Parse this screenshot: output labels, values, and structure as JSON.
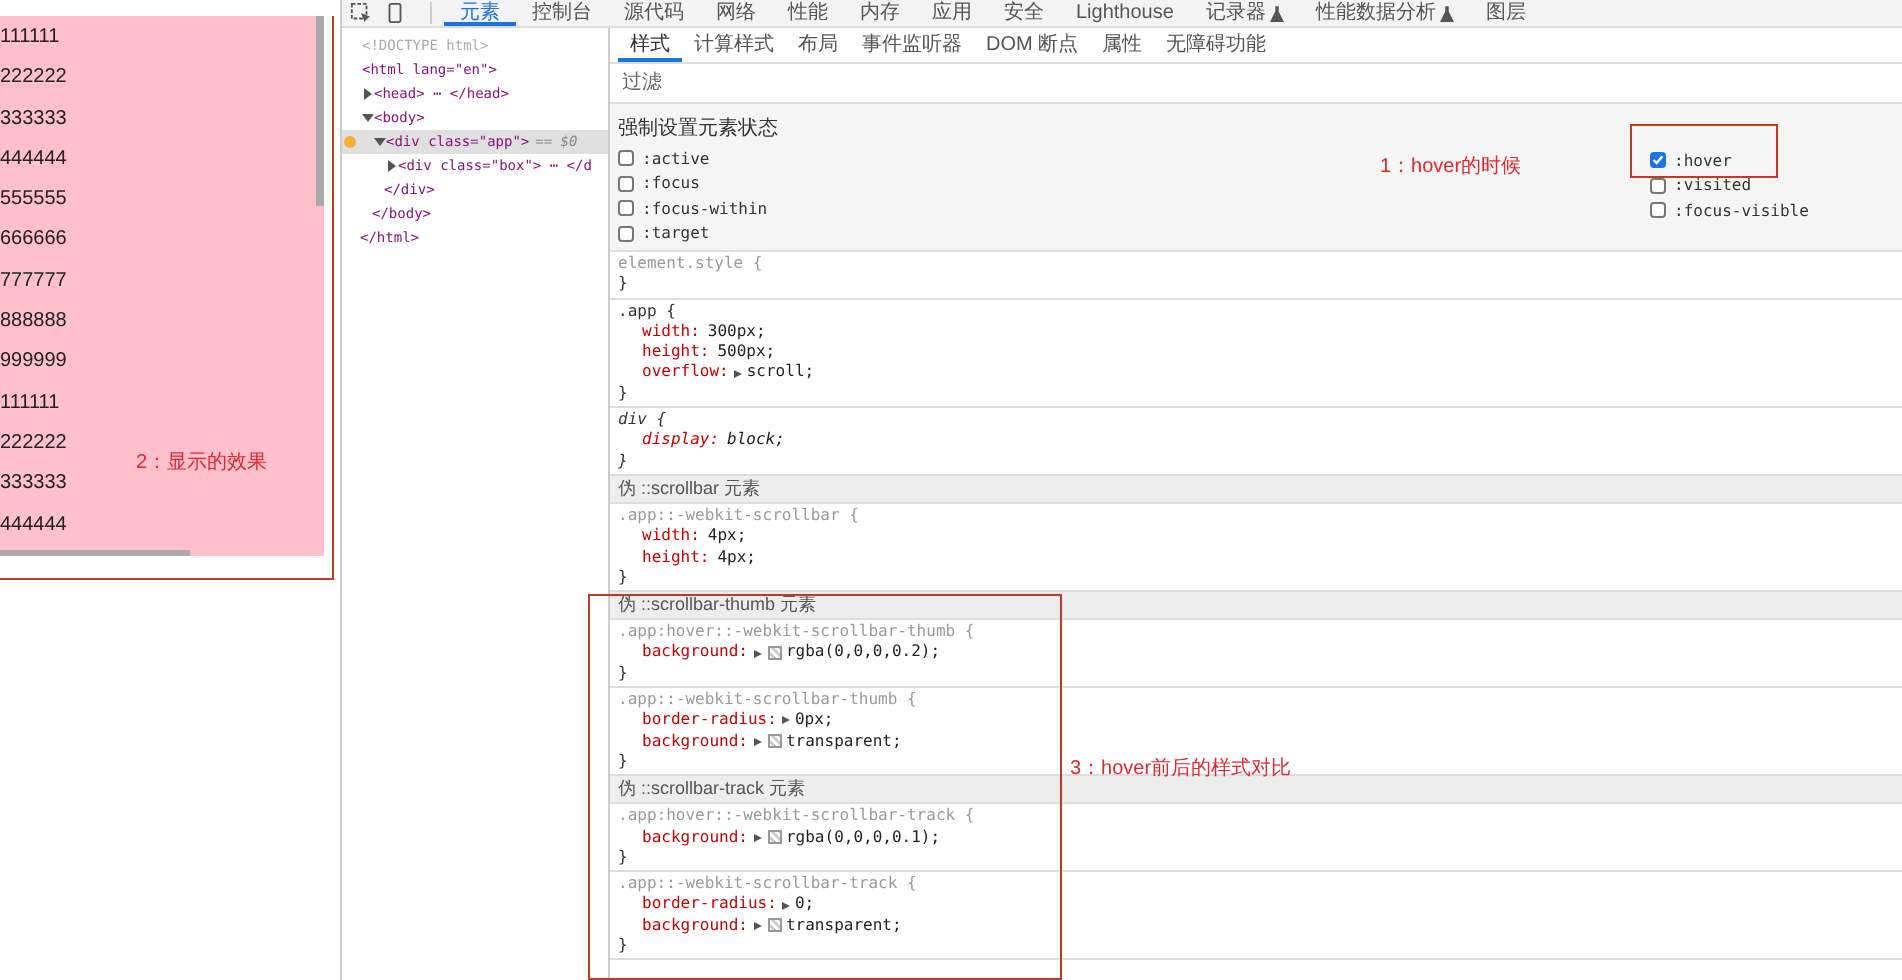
{
  "page": {
    "items": [
      "111111",
      "222222",
      "333333",
      "444444",
      "555555",
      "666666",
      "777777",
      "888888",
      "999999",
      "111111",
      "222222",
      "333333",
      "444444"
    ]
  },
  "devtools": {
    "tabs": [
      {
        "label": "元素",
        "selected": true,
        "icon": false
      },
      {
        "label": "控制台",
        "selected": false,
        "icon": false
      },
      {
        "label": "源代码",
        "selected": false,
        "icon": false
      },
      {
        "label": "网络",
        "selected": false,
        "icon": false
      },
      {
        "label": "性能",
        "selected": false,
        "icon": false
      },
      {
        "label": "内存",
        "selected": false,
        "icon": false
      },
      {
        "label": "应用",
        "selected": false,
        "icon": false
      },
      {
        "label": "安全",
        "selected": false,
        "icon": false
      },
      {
        "label": "Lighthouse",
        "selected": false,
        "icon": false
      },
      {
        "label": "记录器",
        "selected": false,
        "icon": true
      },
      {
        "label": "性能数据分析",
        "selected": false,
        "icon": true
      },
      {
        "label": "图层",
        "selected": false,
        "icon": false
      }
    ],
    "dom_tree": [
      {
        "text": "<!DOCTYPE html>",
        "dimmed": true,
        "selected": false
      },
      {
        "text": "<html lang=\"en\">",
        "dimmed": false,
        "selected": false,
        "close": "</html>",
        "children": [
          {
            "text": "<head> ⋯ </head>",
            "dimmed": false,
            "expanded": false,
            "selected": false
          },
          {
            "text": "<body>",
            "dimmed": false,
            "expanded": true,
            "selected": false,
            "close": "</body>",
            "children": [
              {
                "text": "<div class=\"app\">",
                "suffix": "== $0",
                "dimmed": false,
                "expanded": true,
                "selected": true,
                "forced_state": true,
                "close": "</div>",
                "children": [
                  {
                    "text": "<div class=\"box\"> ⋯ </d",
                    "dimmed": false,
                    "expanded": false,
                    "selected": false
                  }
                ]
              }
            ]
          }
        ]
      }
    ],
    "style_tabs": [
      {
        "label": "样式",
        "selected": true
      },
      {
        "label": "计算样式",
        "selected": false
      },
      {
        "label": "布局",
        "selected": false
      },
      {
        "label": "事件监听器",
        "selected": false
      },
      {
        "label": "DOM 断点",
        "selected": false
      },
      {
        "label": "属性",
        "selected": false
      },
      {
        "label": "无障碍功能",
        "selected": false
      }
    ],
    "filter": {
      "placeholder": "过滤"
    },
    "force_state": {
      "title": "强制设置元素状态",
      "left": [
        {
          "label": ":active",
          "checked": false
        },
        {
          "label": ":focus",
          "checked": false
        },
        {
          "label": ":focus-within",
          "checked": false
        },
        {
          "label": ":target",
          "checked": false
        }
      ],
      "right": [
        {
          "label": ":hover",
          "checked": true
        },
        {
          "label": ":visited",
          "checked": false
        },
        {
          "label": ":focus-visible",
          "checked": false
        }
      ]
    },
    "rules": [
      {
        "kind": "rule",
        "selector": "element.style {",
        "dimmed": true,
        "user_agent": false,
        "close": "}"
      },
      {
        "kind": "rule",
        "selector": ".app {",
        "dimmed": false,
        "user_agent": false,
        "declarations": [
          {
            "prop": "width:",
            "value": "300px;",
            "arrow": false,
            "swatch": false
          },
          {
            "prop": "height:",
            "value": "500px;",
            "arrow": false,
            "swatch": false
          },
          {
            "prop": "overflow:",
            "value": "scroll;",
            "arrow": true,
            "swatch": false
          }
        ],
        "close": "}"
      },
      {
        "kind": "rule",
        "selector": "div {",
        "dimmed": false,
        "user_agent": true,
        "declarations": [
          {
            "prop": "display:",
            "value": "block;",
            "arrow": false,
            "swatch": false
          }
        ],
        "close": "}"
      },
      {
        "kind": "header",
        "text": "伪 ::scrollbar 元素"
      },
      {
        "kind": "rule",
        "selector": ".app::-webkit-scrollbar {",
        "dimmed": true,
        "user_agent": false,
        "declarations": [
          {
            "prop": "width:",
            "value": "4px;",
            "arrow": false,
            "swatch": false
          },
          {
            "prop": "height:",
            "value": "4px;",
            "arrow": false,
            "swatch": false
          }
        ],
        "close": "}"
      },
      {
        "kind": "header",
        "text": "伪 ::scrollbar-thumb 元素"
      },
      {
        "kind": "rule",
        "selector": ".app:hover::-webkit-scrollbar-thumb {",
        "dimmed": true,
        "user_agent": false,
        "declarations": [
          {
            "prop": "background:",
            "value": "rgba(0,0,0,0.2);",
            "arrow": true,
            "swatch": true
          }
        ],
        "close": "}"
      },
      {
        "kind": "rule",
        "selector": ".app::-webkit-scrollbar-thumb {",
        "dimmed": true,
        "user_agent": false,
        "declarations": [
          {
            "prop": "border-radius:",
            "value": "0px;",
            "arrow": true,
            "swatch": false
          },
          {
            "prop": "background:",
            "value": "transparent;",
            "arrow": true,
            "swatch": true
          }
        ],
        "close": "}"
      },
      {
        "kind": "header",
        "text": "伪 ::scrollbar-track 元素"
      },
      {
        "kind": "rule",
        "selector": ".app:hover::-webkit-scrollbar-track {",
        "dimmed": true,
        "user_agent": false,
        "declarations": [
          {
            "prop": "background:",
            "value": "rgba(0,0,0,0.1);",
            "arrow": true,
            "swatch": true
          }
        ],
        "close": "}"
      },
      {
        "kind": "rule",
        "selector": ".app::-webkit-scrollbar-track {",
        "dimmed": true,
        "user_agent": false,
        "declarations": [
          {
            "prop": "border-radius:",
            "value": "0;",
            "arrow": true,
            "swatch": false
          },
          {
            "prop": "background:",
            "value": "transparent;",
            "arrow": true,
            "swatch": true
          }
        ],
        "close": "}"
      }
    ]
  },
  "annotations": [
    {
      "text": "1：hover的时候"
    },
    {
      "text": "2：显示的效果"
    },
    {
      "text": "3：hover前后的样式对比"
    }
  ]
}
